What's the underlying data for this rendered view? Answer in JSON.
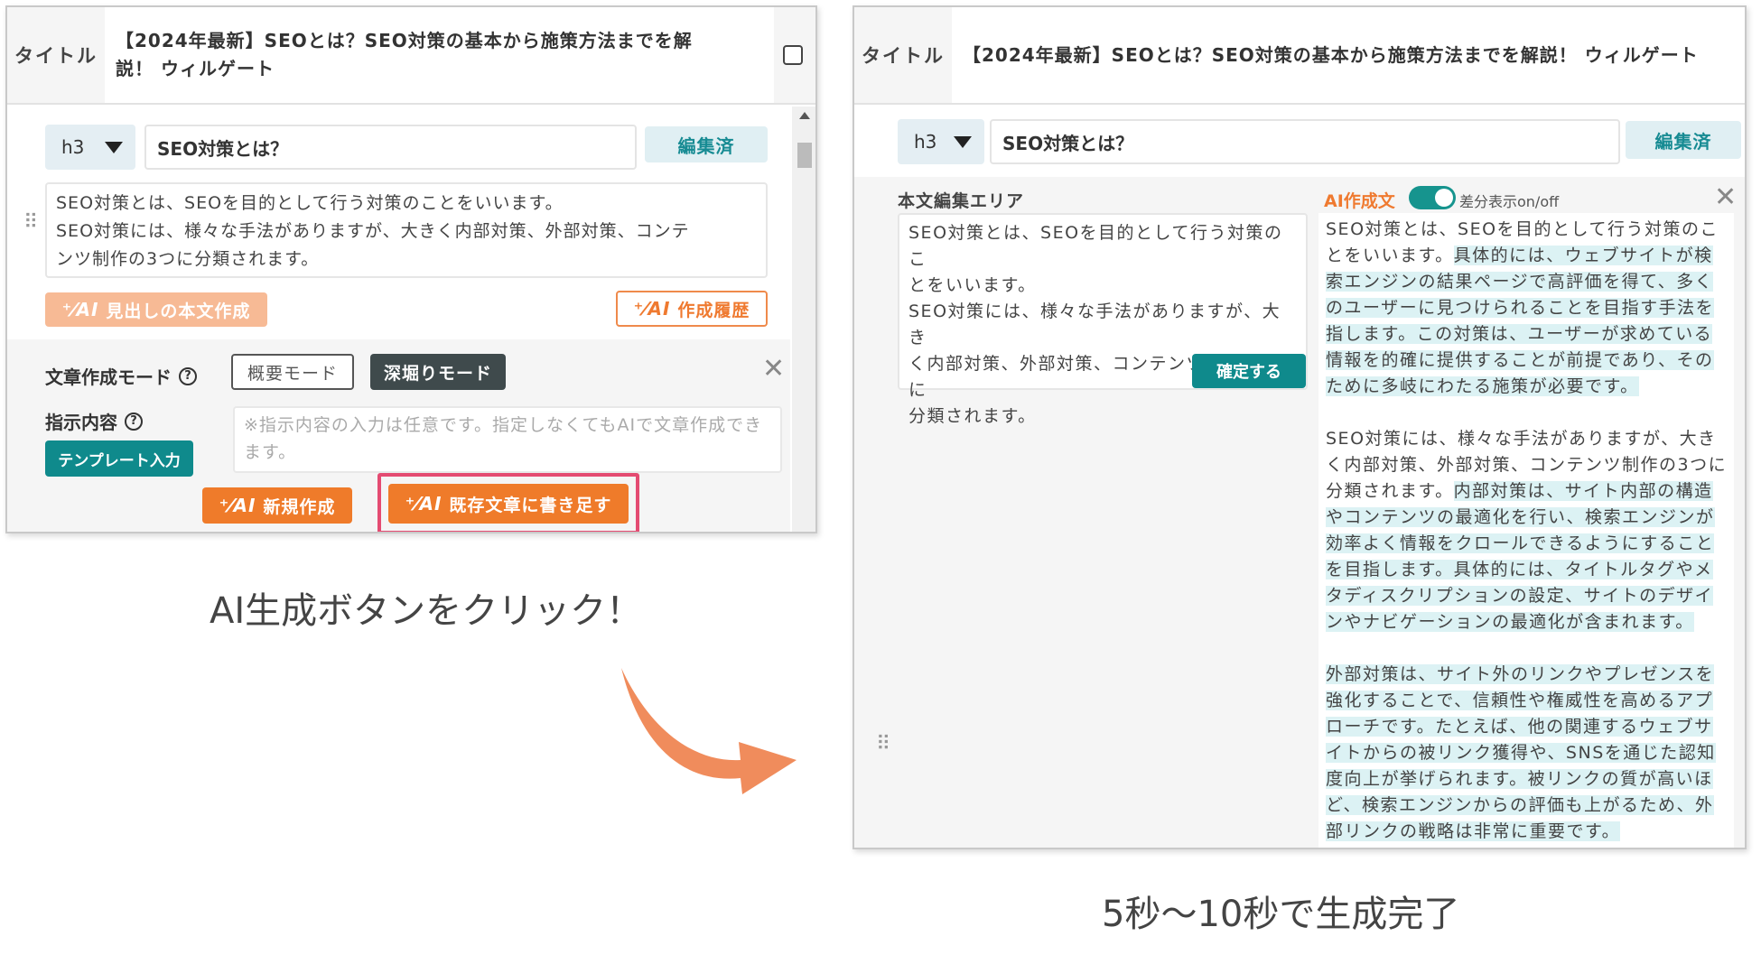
{
  "left": {
    "title_label": "タイトル",
    "title_text": "【2024年最新】SEOとは？SEO対策の基本から施策方法までを解説！ ウィルゲート",
    "heading_level": "h3",
    "heading_text": "SEO対策とは？",
    "edited_label": "編集済",
    "body_lines": [
      "SEO対策とは、SEOを目的として行う対策のことをいいます。",
      "SEO対策には、様々な手法がありますが、大きく内部対策、外部対策、コンテ",
      "ンツ制作の3つに分類されます。"
    ],
    "ai_mark": "⁺⁄AI",
    "heading_body_btn": "見出しの本文作成",
    "history_btn": "作成履歴",
    "mode_label": "文章作成モード",
    "mode_summary": "概要モード",
    "mode_deep": "深堀りモード",
    "instruction_label": "指示内容",
    "template_btn": "テンプレート入力",
    "instruction_placeholder": "※指示内容の入力は任意です。指定しなくてもAIで文章作成できます。",
    "new_btn": "新規作成",
    "append_btn": "既存文章に書き足す",
    "help_glyph": "?",
    "close_glyph": "✕"
  },
  "right": {
    "title_label": "タイトル",
    "title_text": "【2024年最新】SEOとは？SEO対策の基本から施策方法までを解説！ ウィルゲート",
    "heading_level": "h3",
    "heading_text": "SEO対策とは？",
    "edited_label": "編集済",
    "body_area_label": "本文編集エリア",
    "body_lines": [
      "SEO対策とは、SEOを目的として行う対策のこ",
      "とをいいます。",
      "SEO対策には、様々な手法がありますが、大き",
      "く内部対策、外部対策、コンテンツ制作の3つに",
      "分類されます。"
    ],
    "confirm_btn": "確定する",
    "ai_label": "AI作成文",
    "diff_toggle_label": "差分表示on/off",
    "diff_toggle_on": true,
    "close_glyph": "✕",
    "ai_paragraphs": [
      [
        {
          "t": "SEO対策とは、SEOを目的として行う対策のことをいいます。",
          "hl": false
        },
        {
          "t": "具体的には、ウェブサイトが検索エンジンの結果ページで高評価を得て、多くのユーザーに見つけられることを目指す手法を指します。この対策は、ユーザーが求めている情報を的確に提供することが前提であり、そのために多岐にわたる施策が必要です。",
          "hl": true
        }
      ],
      [
        {
          "t": "SEO対策には、様々な手法がありますが、大きく内部対策、外部対策、コンテンツ制作の3つに分類されます。",
          "hl": false
        },
        {
          "t": "内部対策は、サイト内部の構造やコンテンツの最適化を行い、検索エンジンが効率よく情報をクロールできるようにすることを目指します。具体的には、タイトルタグやメタディスクリプションの設定、サイトのデザインやナビゲーションの最適化が含まれます。",
          "hl": true
        }
      ],
      [
        {
          "t": "外部対策は、サイト外のリンクやプレゼンスを強化することで、信頼性や権威性を高めるアプローチです。たとえば、他の関連するウェブサイトからの被リンク獲得や、SNSを通じた認知度向上が挙げられます。被リンクの質が高いほど、検索エンジンからの評価も上がるため、外部リンクの戦略は非常に重要です。",
          "hl": true
        }
      ]
    ]
  },
  "captions": {
    "click": "AI生成ボタンをクリック！",
    "done": "5秒～10秒で生成完了"
  },
  "colors": {
    "accent_orange": "#ef7b2a",
    "teal": "#0f8a8c",
    "highlight_frame": "#e44b72",
    "diff_highlight": "#dcf2f4"
  }
}
